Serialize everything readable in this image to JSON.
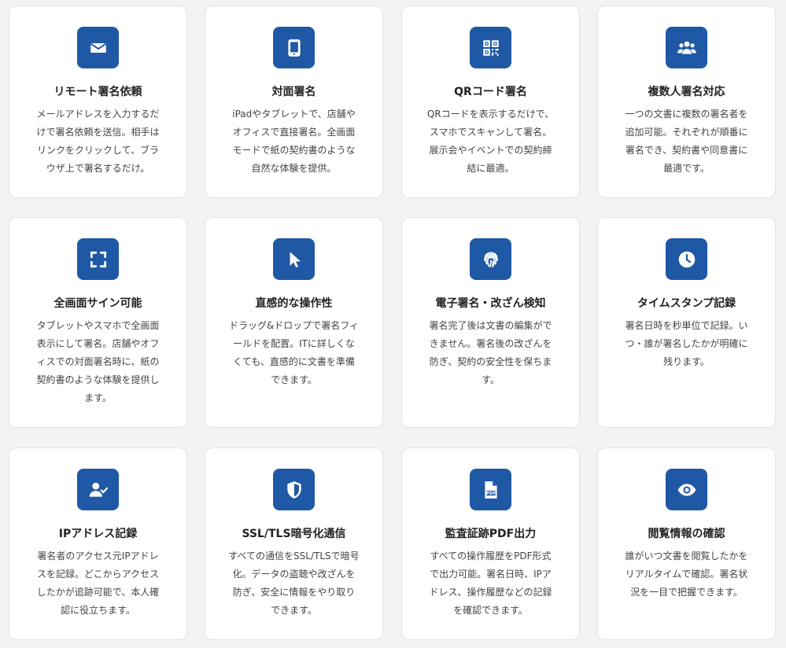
{
  "colors": {
    "background": "#f3f3f3",
    "card": "#ffffff",
    "icon_bg": "#1f58a5",
    "title": "#222222",
    "text": "#444444"
  },
  "features": [
    {
      "icon": "envelope-icon",
      "title": "リモート署名依頼",
      "lines": [
        "メールアドレスを入力するだ",
        "けで署名依頼を送信。相手は",
        "リンクをクリックして、ブラ",
        "ウザ上で署名するだけ。"
      ]
    },
    {
      "icon": "tablet-icon",
      "title": "対面署名",
      "lines": [
        "iPadやタブレットで、店舗や",
        "オフィスで直接署名。全画面",
        "モードで紙の契約書のような",
        "自然な体験を提供。"
      ]
    },
    {
      "icon": "qrcode-icon",
      "title": "QRコード署名",
      "lines": [
        "QRコードを表示するだけで、",
        "スマホでスキャンして署名。",
        "展示会やイベントでの契約締",
        "結に最適。"
      ]
    },
    {
      "icon": "users-icon",
      "title": "複数人署名対応",
      "lines": [
        "一つの文書に複数の署名者を",
        "追加可能。それぞれが順番に",
        "署名でき、契約書や同意書に",
        "最適です。"
      ]
    },
    {
      "icon": "expand-icon",
      "title": "全画面サイン可能",
      "lines": [
        "タブレットやスマホで全画面",
        "表示にして署名。店舗やオフ",
        "ィスでの対面署名時に、紙の",
        "契約書のような体験を提供し",
        "ます。"
      ]
    },
    {
      "icon": "pointer-icon",
      "title": "直感的な操作性",
      "lines": [
        "ドラッグ&ドロップで署名フィ",
        "ールドを配置。ITに詳しくな",
        "くても、直感的に文書を準備",
        "できます。"
      ]
    },
    {
      "icon": "fingerprint-icon",
      "title": "電子署名・改ざん検知",
      "lines": [
        "署名完了後は文書の編集がで",
        "きません。署名後の改ざんを",
        "防ぎ、契約の安全性を保ちま",
        "す。"
      ]
    },
    {
      "icon": "clock-icon",
      "title": "タイムスタンプ記録",
      "lines": [
        "署名日時を秒単位で記録。い",
        "つ・誰が署名したかが明確に",
        "残ります。"
      ]
    },
    {
      "icon": "user-check-icon",
      "title": "IPアドレス記録",
      "lines": [
        "署名者のアクセス元IPアドレ",
        "スを記録。どこからアクセス",
        "したかが追跡可能で、本人確",
        "認に役立ちます。"
      ]
    },
    {
      "icon": "shield-icon",
      "title": "SSL/TLS暗号化通信",
      "lines": [
        "すべての通信をSSL/TLSで暗号",
        "化。データの盗聴や改ざんを",
        "防ぎ、安全に情報をやり取り",
        "できます。"
      ]
    },
    {
      "icon": "pdf-file-icon",
      "title": "監査証跡PDF出力",
      "lines": [
        "すべての操作履歴をPDF形式",
        "で出力可能。署名日時、IPア",
        "ドレス、操作履歴などの記録",
        "を確認できます。"
      ]
    },
    {
      "icon": "eye-icon",
      "title": "閲覧情報の確認",
      "lines": [
        "誰がいつ文書を閲覧したかを",
        "リアルタイムで確認。署名状",
        "況を一目で把握できます。"
      ]
    }
  ]
}
